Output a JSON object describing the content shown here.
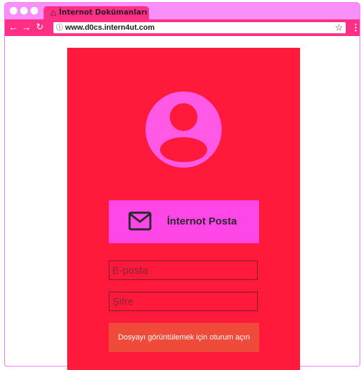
{
  "browser": {
    "tab_title": "İnternot Dokümanları",
    "tab_icon": "warning-icon",
    "url": "www.d0cs.intern4ut.com",
    "nav_icons": [
      "back-arrow-icon",
      "forward-arrow-icon",
      "reload-icon",
      "info-icon",
      "star-icon",
      "more-vert-icon"
    ]
  },
  "login": {
    "avatar_icon": "user-avatar-icon",
    "mail_button_label": "İnternot Posta",
    "mail_icon": "envelope-icon",
    "email_placeholder": "E-posta",
    "password_placeholder": "Şifre",
    "signin_label": "Dosyayı görüntülemek için oturum açın"
  },
  "colors": {
    "chrome": "#ff2f86",
    "tabbar": "#f98ff9",
    "panel": "#ff1a3c",
    "accent": "#ff46e6",
    "signin": "#f04b3a"
  }
}
